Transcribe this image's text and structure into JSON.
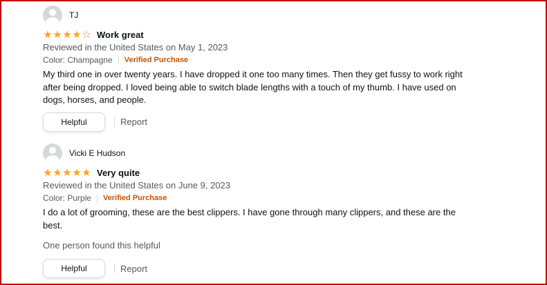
{
  "colors": {
    "star": "#ffa41c",
    "verified": "#c45500",
    "frame": "#c40000"
  },
  "reviews": [
    {
      "author": "TJ",
      "rating": 4,
      "stars_display": [
        "★",
        "★",
        "★",
        "★",
        "☆"
      ],
      "title": "Work great",
      "reviewed": "Reviewed in the United States on May 1, 2023",
      "color_label": "Color: Champagne",
      "verified": "Verified Purchase",
      "body": "My third one in over twenty years. I have dropped it one too many times. Then they get fussy to work right after being dropped. I loved being able to switch blade lengths with a touch of my thumb. I have used on dogs, horses, and people.",
      "helpful_count_text": "",
      "helpful_button": "Helpful",
      "report_link": "Report"
    },
    {
      "author": "Vicki E Hudson",
      "rating": 5,
      "stars_display": [
        "★",
        "★",
        "★",
        "★",
        "★"
      ],
      "title": "Very quite",
      "reviewed": "Reviewed in the United States on June 9, 2023",
      "color_label": "Color: Purple",
      "verified": "Verified Purchase",
      "body": "I do a lot of grooming, these are the best clippers. I have gone through many clippers, and these are the best.",
      "helpful_count_text": "One person found this helpful",
      "helpful_button": "Helpful",
      "report_link": "Report"
    }
  ]
}
